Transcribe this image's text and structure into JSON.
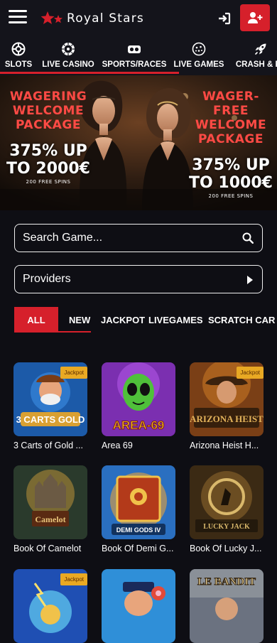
{
  "header": {
    "logo_text": "Royal Stars",
    "icons": {
      "menu": "hamburger-icon",
      "login": "login-icon",
      "register": "add-user-icon"
    }
  },
  "categories": [
    {
      "label": "SLOTS",
      "icon": "slot-reel-icon",
      "active": true
    },
    {
      "label": "LIVE CASINO",
      "icon": "roulette-icon",
      "active": true
    },
    {
      "label": "SPORTS/RACES",
      "icon": "vr-goggles-icon",
      "active": true
    },
    {
      "label": "LIVE GAMES",
      "icon": "ball-icon",
      "active": true
    },
    {
      "label": "CRASH & FA",
      "icon": "rocket-icon",
      "active": false
    }
  ],
  "banner": {
    "left": {
      "headline_1": "WAGERING",
      "headline_2": "WELCOME",
      "headline_3": "PACKAGE",
      "offer_1": "375% UP",
      "offer_2": "TO 2000€",
      "spins": "200 FREE SPINS"
    },
    "right": {
      "headline_1": "WAGER-FREE",
      "headline_2": "WELCOME",
      "headline_3": "PACKAGE",
      "offer_1": "375% UP",
      "offer_2": "TO 1000€",
      "spins": "200 FREE SPINS"
    }
  },
  "search": {
    "placeholder": "Search Game..."
  },
  "providers": {
    "label": "Providers"
  },
  "filters": [
    "ALL",
    "NEW",
    "JACKPOT",
    "LIVEGAMES",
    "SCRATCH CAR"
  ],
  "games": [
    {
      "name": "3 Carts of Gold ...",
      "badge": "Jackpot",
      "art": "3 CARTS GOLD",
      "colors": [
        "#1c5aa8",
        "#d9a032"
      ]
    },
    {
      "name": "Area 69",
      "badge": "",
      "art": "AREA-69",
      "colors": [
        "#7b2fb0",
        "#4fc03a"
      ]
    },
    {
      "name": "Arizona Heist H...",
      "badge": "Jackpot",
      "art": "ARIZONA HEIST",
      "colors": [
        "#7a3f16",
        "#e2b25a"
      ]
    },
    {
      "name": "Book Of Camelot",
      "badge": "",
      "art": "Camelot",
      "colors": [
        "#2a3a2c",
        "#d2a23c"
      ]
    },
    {
      "name": "Book Of Demi G...",
      "badge": "",
      "art": "DEMI GODS IV",
      "colors": [
        "#c0601e",
        "#2a6fc0"
      ]
    },
    {
      "name": "Book Of Lucky J...",
      "badge": "",
      "art": "LUCKY JACK",
      "colors": [
        "#3b2a14",
        "#d9b86b"
      ]
    },
    {
      "name": "",
      "badge": "Jackpot",
      "art": "",
      "colors": [
        "#1f4fb3",
        "#4fa9e0"
      ]
    },
    {
      "name": "",
      "badge": "",
      "art": "",
      "colors": [
        "#2f8fd8",
        "#e24a3a"
      ]
    },
    {
      "name": "",
      "badge": "",
      "art": "LE BANDIT",
      "colors": [
        "#6b7280",
        "#efd79a"
      ]
    }
  ]
}
